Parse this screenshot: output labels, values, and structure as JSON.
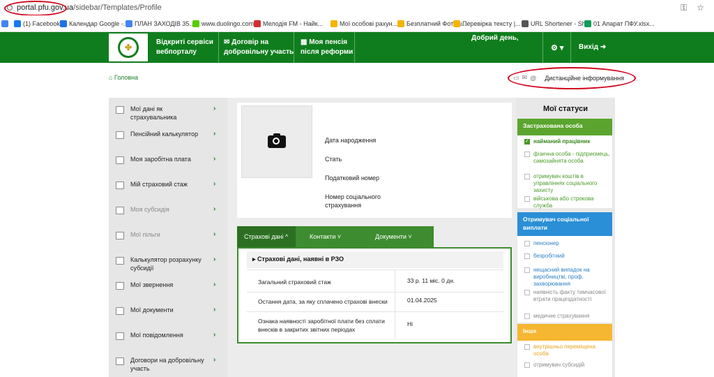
{
  "browser": {
    "url_host": "portal.pfu.gov.ua",
    "url_path": "/sidebar/Templates/Profile",
    "bookmarks": [
      {
        "label": "",
        "color": "#4285f4"
      },
      {
        "label": "(1) Facebook",
        "color": "#1877f2"
      },
      {
        "label": "Календар Google -...",
        "color": "#1a73e8"
      },
      {
        "label": "ПЛАН ЗАХОДІВ 35...",
        "color": "#4285f4"
      },
      {
        "label": "www.duolingo.com",
        "color": "#58cc02"
      },
      {
        "label": "Мелодія FM - Найк...",
        "color": "#d32f2f"
      },
      {
        "label": "Мої особові рахун...",
        "color": "#f4b400"
      },
      {
        "label": "Безплатний Фотош...",
        "color": "#f4b400"
      },
      {
        "label": "Перевірка тексту |...",
        "color": "#f4b400"
      },
      {
        "label": "URL Shortener - Sh...",
        "color": "#555555"
      },
      {
        "label": "01 Апарат ПФУ.xlsx...",
        "color": "#0f9d58"
      }
    ]
  },
  "header": {
    "nav": [
      {
        "line1": "Відкриті сервіси",
        "line2": "вебпорталу"
      },
      {
        "line1": "✉ Договір на",
        "line2": "добровільну участь"
      },
      {
        "line1": "▦ Моя пенсія",
        "line2": "після реформи"
      }
    ],
    "greeting": "Добрий день,",
    "settings": "⚙ ▾",
    "logout": "Вихід ➜"
  },
  "breadcrumb": "⌂ Головна",
  "distant_info": "Дистанційне інформування",
  "sidebar": [
    {
      "label": "Мої дані як страхувальника",
      "disabled": false
    },
    {
      "label": "Пенсійний калькулятор",
      "disabled": false
    },
    {
      "label": "Моя заробітна плата",
      "disabled": false
    },
    {
      "label": "Мій страховий стаж",
      "disabled": false
    },
    {
      "label": "Моя субсидія",
      "disabled": true
    },
    {
      "label": "Мої пільги",
      "disabled": true
    },
    {
      "label": "Калькулятор розрахунку субсидії",
      "disabled": false
    },
    {
      "label": "Мої звернення",
      "disabled": false
    },
    {
      "label": "Мої документи",
      "disabled": false
    },
    {
      "label": "Мої повідомлення",
      "disabled": false
    },
    {
      "label": "Договори на добровільну участь",
      "disabled": false
    }
  ],
  "profile": {
    "fields": [
      "Дата народження",
      "Стать",
      "Податковий номер",
      "Номер соціального страхування"
    ]
  },
  "tabs": [
    "Страхові дані ^",
    "Контакти ˅",
    "Документи ˅"
  ],
  "insurance": {
    "heading": "Страхові дані, наявні в РЗО",
    "rows": [
      {
        "label": "Загальний страховий стаж",
        "value": "33 р. 11 міс. 0 дн."
      },
      {
        "label": "Остання дата, за яку сплачено страхові внески",
        "value": "01.04.2025"
      },
      {
        "label": "Ознака наявності заробітної плати без сплати внесків в закритих звітних періодах",
        "value": "Ні"
      }
    ]
  },
  "statuses": {
    "title": "Мої статуси",
    "groups": [
      {
        "title": "Застрахована особа",
        "color": "#5ba52e",
        "items": [
          {
            "label": "найманий працівник",
            "checked": true
          },
          {
            "label": "фізична особа - підприємець, самозайнята особа",
            "checked": false
          },
          {
            "label": "отримувач коштів в управліннях соціального захисту",
            "checked": false
          },
          {
            "label": "військова або строкова служба",
            "checked": false
          }
        ]
      },
      {
        "title": "Отримувач соціальної виплати",
        "color": "#2a8fd6",
        "items": [
          {
            "label": "пенсіонер",
            "checked": false
          },
          {
            "label": "безробітний",
            "checked": false
          },
          {
            "label": "нещасний випадок на виробництві, проф. захворювання",
            "checked": false
          },
          {
            "label": "наявність факту тимчасової втрати працездатності",
            "checked": false
          },
          {
            "label": "медичне страхування",
            "checked": false
          }
        ]
      },
      {
        "title": "Інше",
        "color": "#f5b731",
        "items": [
          {
            "label": "внутрішньо переміщена особа",
            "checked": false
          },
          {
            "label": "отримувач субсидій",
            "checked": false
          }
        ]
      }
    ]
  }
}
